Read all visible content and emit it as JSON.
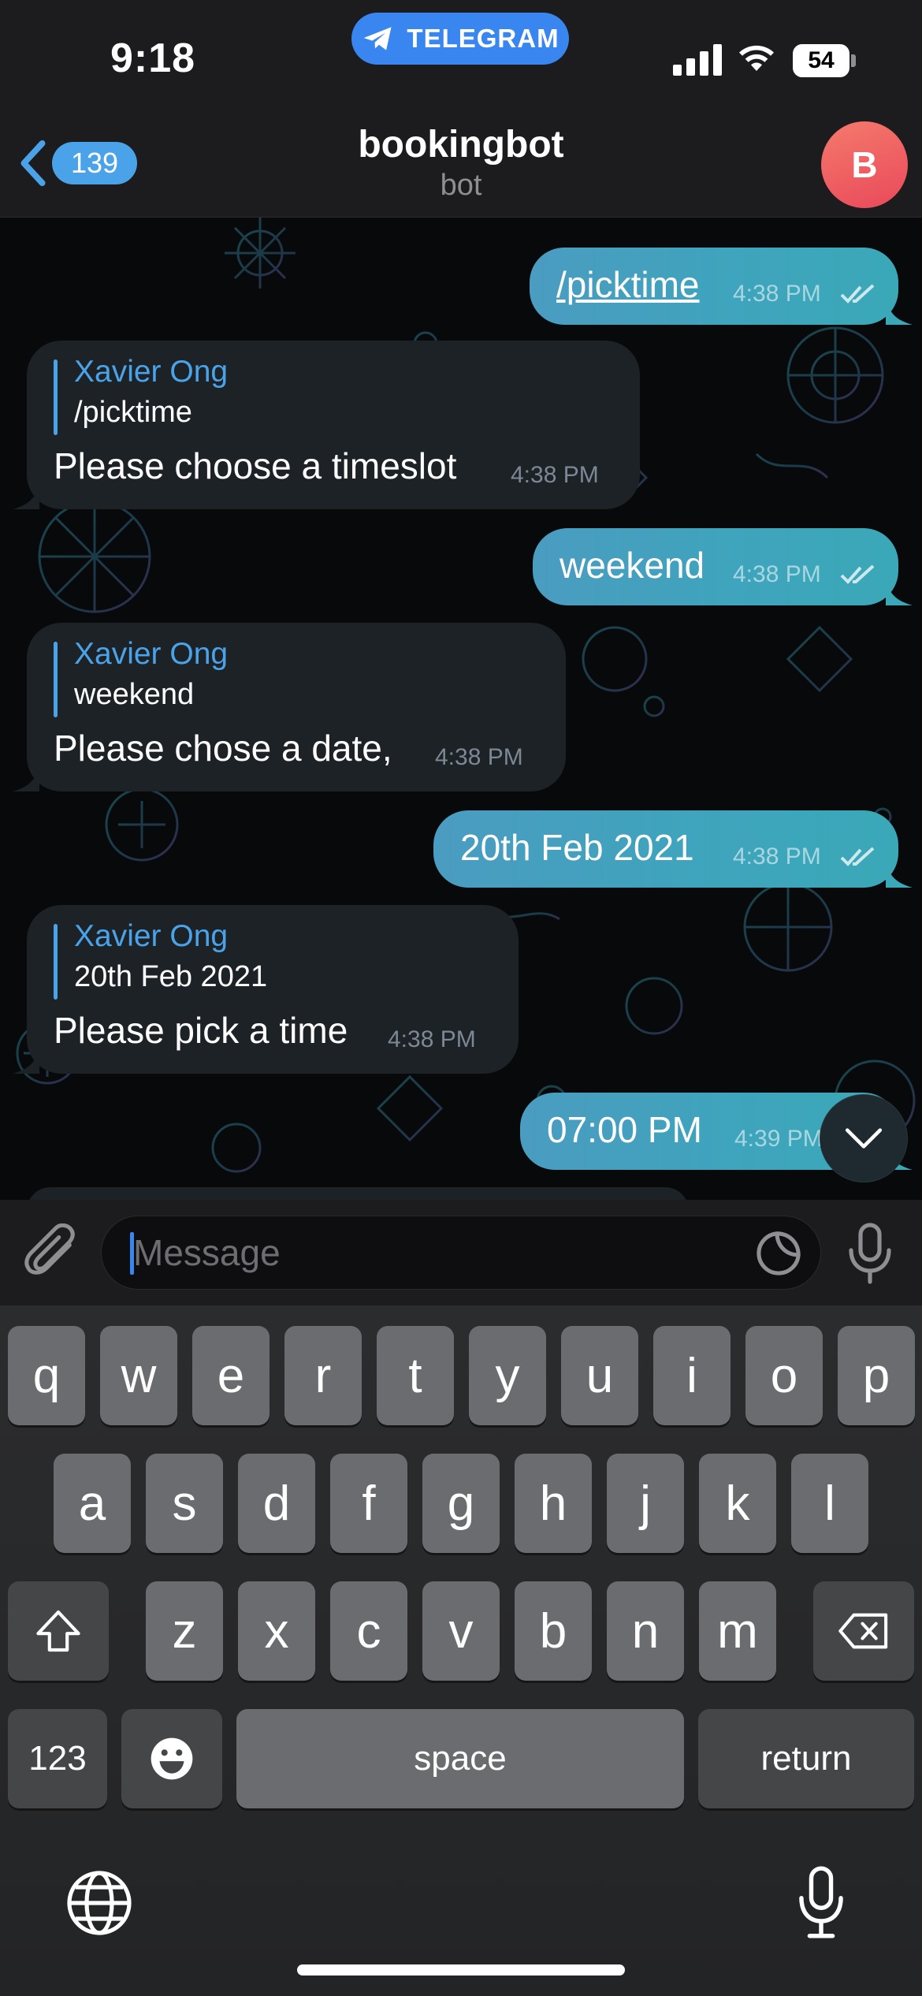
{
  "status_bar": {
    "time": "9:18",
    "app_pill": "TELEGRAM",
    "battery": "54"
  },
  "header": {
    "back_count": "139",
    "title": "bookingbot",
    "subtitle": "bot",
    "avatar_letter": "B"
  },
  "messages": [
    {
      "direction": "out",
      "text": "/picktime",
      "time": "4:38 PM",
      "is_command": true
    },
    {
      "direction": "in",
      "reply_name": "Xavier Ong",
      "reply_text": "/picktime",
      "text": "Please choose a timeslot",
      "time": "4:38 PM"
    },
    {
      "direction": "out",
      "text": "weekend",
      "time": "4:38 PM"
    },
    {
      "direction": "in",
      "reply_name": "Xavier Ong",
      "reply_text": "weekend",
      "text": "Please chose a date,",
      "time": "4:38 PM"
    },
    {
      "direction": "out",
      "text": "20th Feb 2021",
      "time": "4:38 PM"
    },
    {
      "direction": "in",
      "reply_name": "Xavier Ong",
      "reply_text": "20th Feb 2021",
      "text": "Please pick a time",
      "time": "4:38 PM"
    },
    {
      "direction": "out",
      "text": "07:00 PM",
      "time": "4:39 PM"
    }
  ],
  "composer": {
    "placeholder": "Message"
  },
  "keyboard": {
    "row1": [
      "q",
      "w",
      "e",
      "r",
      "t",
      "y",
      "u",
      "i",
      "o",
      "p"
    ],
    "row2": [
      "a",
      "s",
      "d",
      "f",
      "g",
      "h",
      "j",
      "k",
      "l"
    ],
    "row3": [
      "z",
      "x",
      "c",
      "v",
      "b",
      "n",
      "m"
    ],
    "numbers": "123",
    "space": "space",
    "return": "return"
  },
  "icons": {
    "telegram": "telegram-plane-icon",
    "back": "chevron-left-icon",
    "read": "double-check-icon",
    "scroll_down": "chevron-down-icon",
    "attach": "paperclip-icon",
    "sticker": "sticker-icon",
    "mic": "microphone-icon",
    "shift": "shift-icon",
    "delete": "backspace-icon",
    "emoji": "emoji-icon",
    "globe": "globe-icon"
  },
  "colors": {
    "accent": "#4aa3e8",
    "outgoing_bubble": "#3fa4bd",
    "incoming_bubble": "#1d2227",
    "avatar": "#ee5a64",
    "telegram_pill": "#3a86f0"
  }
}
